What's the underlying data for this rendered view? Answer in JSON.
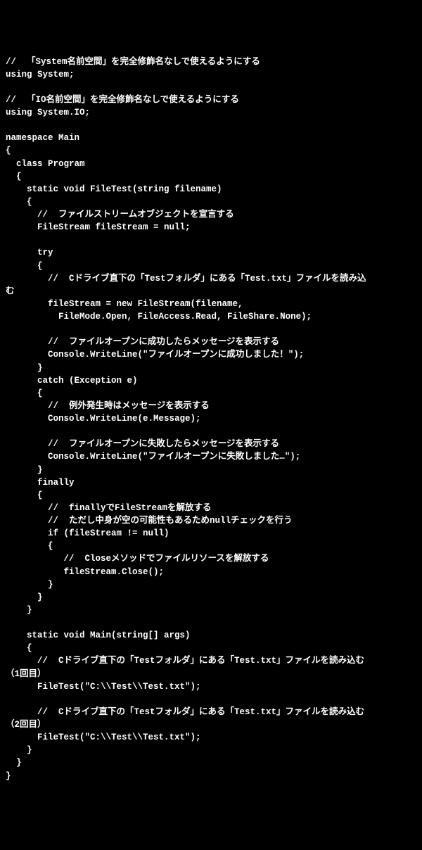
{
  "lines": [
    "//  「System名前空間」を完全修飾名なしで使えるようにする",
    "using System;",
    "",
    "//  「IO名前空間」を完全修飾名なしで使えるようにする",
    "using System.IO;",
    "",
    "namespace Main",
    "{",
    "  class Program",
    "  {",
    "    static void FileTest(string filename)",
    "    {",
    "      //  ファイルストリームオブジェクトを宣言する",
    "      FileStream fileStream = null;",
    "",
    "      try",
    "      {",
    "        //  Cドライブ直下の「Testフォルダ」にある「Test.txt」ファイルを読み込",
    "む",
    "        fileStream = new FileStream(filename,",
    "          FileMode.Open, FileAccess.Read, FileShare.None);",
    "",
    "        //  ファイルオープンに成功したらメッセージを表示する",
    "        Console.WriteLine(\"ファイルオープンに成功しました！\");",
    "      }",
    "      catch (Exception e)",
    "      {",
    "        //  例外発生時はメッセージを表示する",
    "        Console.WriteLine(e.Message);",
    "",
    "        //  ファイルオープンに失敗したらメッセージを表示する",
    "        Console.WriteLine(\"ファイルオープンに失敗しました…\");",
    "      }",
    "      finally",
    "      {",
    "        //  finallyでFileStreamを解放する",
    "        //  ただし中身が空の可能性もあるためnullチェックを行う",
    "        if (fileStream != null)",
    "        {",
    "           //  Closeメソッドでファイルリソースを解放する",
    "           fileStream.Close();",
    "        }",
    "      }",
    "    }",
    "",
    "    static void Main(string[] args)",
    "    {",
    "      //  Cドライブ直下の「Testフォルダ」にある「Test.txt」ファイルを読み込む",
    "（1回目）",
    "      FileTest(\"C:\\\\Test\\\\Test.txt\");",
    "",
    "      //  Cドライブ直下の「Testフォルダ」にある「Test.txt」ファイルを読み込む",
    "（2回目）",
    "      FileTest(\"C:\\\\Test\\\\Test.txt\");",
    "    }",
    "  }",
    "}"
  ]
}
